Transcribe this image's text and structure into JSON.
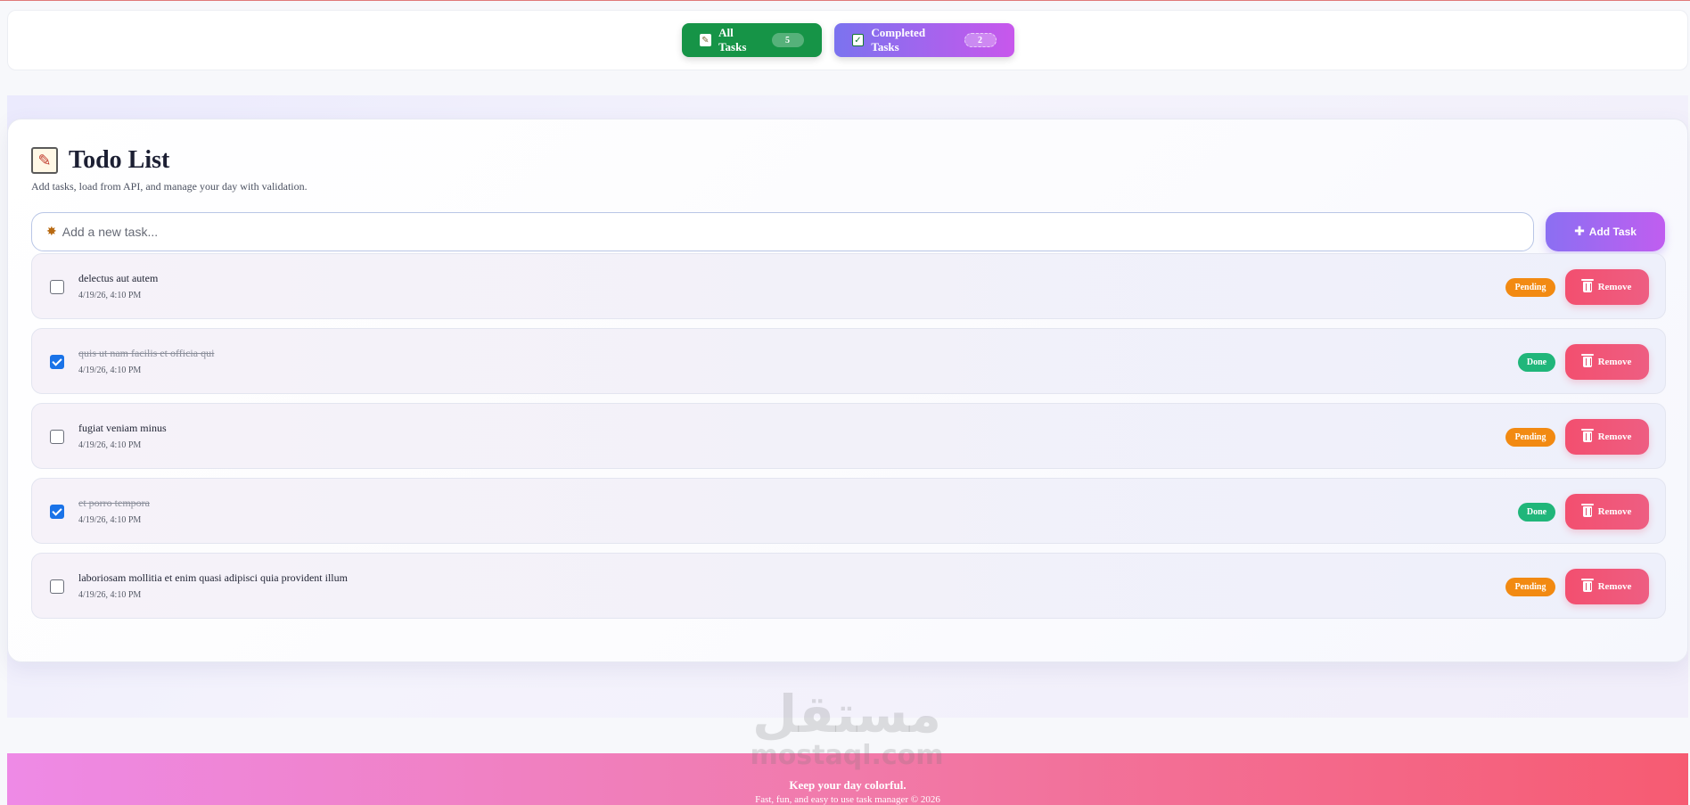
{
  "nav": {
    "all_label": "All Tasks",
    "all_count": "5",
    "completed_label": "Completed Tasks",
    "completed_count": "2"
  },
  "header": {
    "title": "Todo List",
    "subtitle": "Add tasks, load from API, and manage your day with validation."
  },
  "input": {
    "placeholder": "Add a new task...",
    "value": "",
    "add_label": "Add Task"
  },
  "tasks": [
    {
      "name": "delectus aut autem",
      "date": "4/19/26, 4:10 PM",
      "status": "Pending",
      "completed": false,
      "remove_label": "Remove"
    },
    {
      "name": "quis ut nam facilis et officia qui",
      "date": "4/19/26, 4:10 PM",
      "status": "Done",
      "completed": true,
      "remove_label": "Remove"
    },
    {
      "name": "fugiat veniam minus",
      "date": "4/19/26, 4:10 PM",
      "status": "Pending",
      "completed": false,
      "remove_label": "Remove"
    },
    {
      "name": "et porro tempora",
      "date": "4/19/26, 4:10 PM",
      "status": "Done",
      "completed": true,
      "remove_label": "Remove"
    },
    {
      "name": "laboriosam mollitia et enim quasi adipisci quia provident illum",
      "date": "4/19/26, 4:10 PM",
      "status": "Pending",
      "completed": false,
      "remove_label": "Remove"
    }
  ],
  "watermark": {
    "arabic": "مستقل",
    "latin": "mostaql.com"
  },
  "footer": {
    "tagline": "Keep your day colorful.",
    "copyright": "Fast, fun, and easy to use task manager © 2026"
  },
  "colors": {
    "all_tasks": "#169447",
    "completed_from": "#7b73ef",
    "completed_to": "#c857ec",
    "pending": "#f28a12",
    "done": "#20b67a",
    "remove": "#f34f6f"
  },
  "icons": {
    "memo": "memo-icon",
    "check": "check-icon",
    "input": "sparkle-icon",
    "add": "plus-icon",
    "remove": "trash-icon"
  }
}
